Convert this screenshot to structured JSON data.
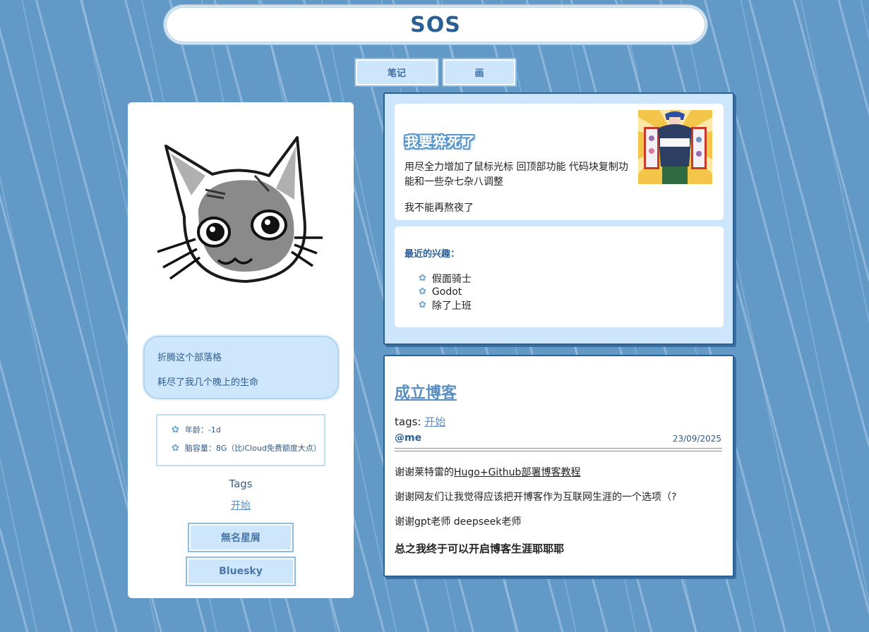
{
  "header": {
    "title": "SOS"
  },
  "nav": {
    "items": [
      {
        "label": "笔记"
      },
      {
        "label": "画"
      }
    ]
  },
  "sidebar": {
    "bubble": {
      "line1": "折腾这个部落格",
      "line2": "耗尽了我几个晚上的生命"
    },
    "stats": [
      {
        "label": "年龄：-1d"
      },
      {
        "label": "脑容量：8G（比iCloud免费额度大点）"
      }
    ],
    "tags_title": "Tags",
    "tags": [
      "开始"
    ],
    "buttons": [
      {
        "label": "無名星屑"
      },
      {
        "label": "Bluesky"
      }
    ]
  },
  "intro": {
    "title": "我要猝死了",
    "p1": "用尽全力增加了鼠标光标 回顶部功能 代码块复制功能和一些杂七杂八调整",
    "p2": "我不能再熬夜了",
    "interests_title": "最近的兴趣：",
    "interests": [
      "假面骑士",
      "Godot",
      "除了上班"
    ]
  },
  "post": {
    "title": "成立博客",
    "tags_label": "tags:",
    "tag": "开始",
    "author": "@me",
    "date": "23/09/2025",
    "p1_prefix": "谢谢莱特雷的",
    "p1_link": "Hugo+Github部署博客教程",
    "p2": "谢谢网友们让我觉得应该把开博客作为互联网生涯的一个选项（?",
    "p3": "谢谢gpt老师 deepseek老师",
    "p4": "总之我终于可以开启博客生涯耶耶耶"
  },
  "icons": {
    "bullet": "flower-icon"
  },
  "colors": {
    "accent": "#2b5e93",
    "link": "#5b8fc3",
    "panel": "#cde6fb",
    "background": "#6299c6"
  }
}
